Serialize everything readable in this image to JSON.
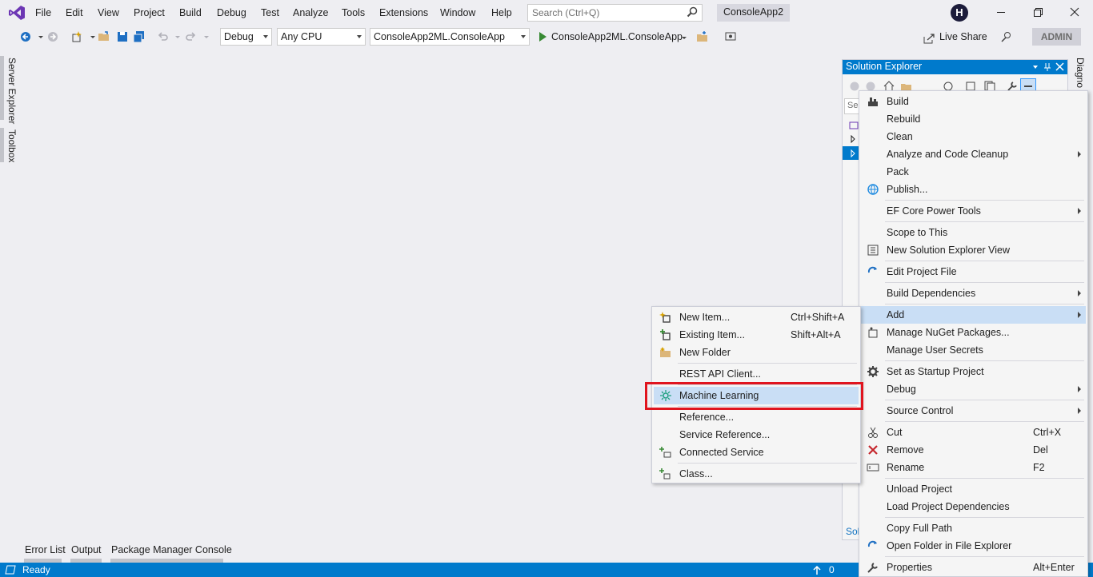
{
  "menubar": {
    "items": [
      "File",
      "Edit",
      "View",
      "Project",
      "Build",
      "Debug",
      "Test",
      "Analyze",
      "Tools",
      "Extensions",
      "Window",
      "Help"
    ],
    "search_placeholder": "Search (Ctrl+Q)",
    "solution_name": "ConsoleApp2",
    "avatar_initial": "H"
  },
  "toolbar": {
    "config": "Debug",
    "platform": "Any CPU",
    "project": "ConsoleApp2ML.ConsoleApp",
    "run_label": "ConsoleApp2ML.ConsoleApp",
    "liveshare": "Live Share",
    "admin": "ADMIN"
  },
  "left_tabs": [
    "Server Explorer",
    "Toolbox"
  ],
  "bottom_tabs": [
    "Error List",
    "Output",
    "Package Manager Console"
  ],
  "status": {
    "text": "Ready",
    "count": "0"
  },
  "solution_explorer": {
    "title": "Solution Explorer",
    "search_placeholder": "Sea",
    "footer": "Sol",
    "diagnostics_tab": "Diagno"
  },
  "project_menu": {
    "items": [
      {
        "label": "Build",
        "icon": "build-icon"
      },
      {
        "label": "Rebuild"
      },
      {
        "label": "Clean"
      },
      {
        "label": "Analyze and Code Cleanup",
        "submenu": true
      },
      {
        "label": "Pack"
      },
      {
        "label": "Publish...",
        "icon": "globe-icon"
      },
      {
        "label": "EF Core Power Tools",
        "submenu": true
      },
      {
        "label": "Scope to This"
      },
      {
        "label": "New Solution Explorer View",
        "icon": "new-view-icon"
      },
      {
        "label": "Edit Project File",
        "icon": "edit-refresh-icon"
      },
      {
        "label": "Build Dependencies",
        "submenu": true
      },
      {
        "label": "Add",
        "submenu": true,
        "highlighted": true
      },
      {
        "label": "Manage NuGet Packages...",
        "icon": "nuget-icon"
      },
      {
        "label": "Manage User Secrets"
      },
      {
        "label": "Set as Startup Project",
        "icon": "gear-icon"
      },
      {
        "label": "Debug",
        "submenu": true
      },
      {
        "label": "Source Control",
        "submenu": true
      },
      {
        "label": "Cut",
        "shortcut": "Ctrl+X",
        "icon": "scissors-icon"
      },
      {
        "label": "Remove",
        "shortcut": "Del",
        "icon": "remove-icon"
      },
      {
        "label": "Rename",
        "shortcut": "F2",
        "icon": "rename-icon"
      },
      {
        "label": "Unload Project"
      },
      {
        "label": "Load Project Dependencies"
      },
      {
        "label": "Copy Full Path"
      },
      {
        "label": "Open Folder in File Explorer",
        "icon": "refresh-icon"
      },
      {
        "label": "Properties",
        "shortcut": "Alt+Enter",
        "icon": "wrench-icon"
      }
    ]
  },
  "add_menu": {
    "items": [
      {
        "label": "New Item...",
        "shortcut": "Ctrl+Shift+A",
        "icon": "new-item-icon"
      },
      {
        "label": "Existing Item...",
        "shortcut": "Shift+Alt+A",
        "icon": "existing-item-icon"
      },
      {
        "label": "New Folder",
        "icon": "folder-icon"
      },
      {
        "label": "REST API Client..."
      },
      {
        "label": "Machine Learning",
        "icon": "ml-icon",
        "highlighted": true
      },
      {
        "label": "Reference..."
      },
      {
        "label": "Service Reference..."
      },
      {
        "label": "Connected Service",
        "icon": "connected-service-icon"
      },
      {
        "label": "Class...",
        "icon": "class-icon"
      }
    ]
  },
  "colors": {
    "accent": "#007acc",
    "highlight_box": "#e0141e",
    "menu_highlight": "#c9def5"
  }
}
